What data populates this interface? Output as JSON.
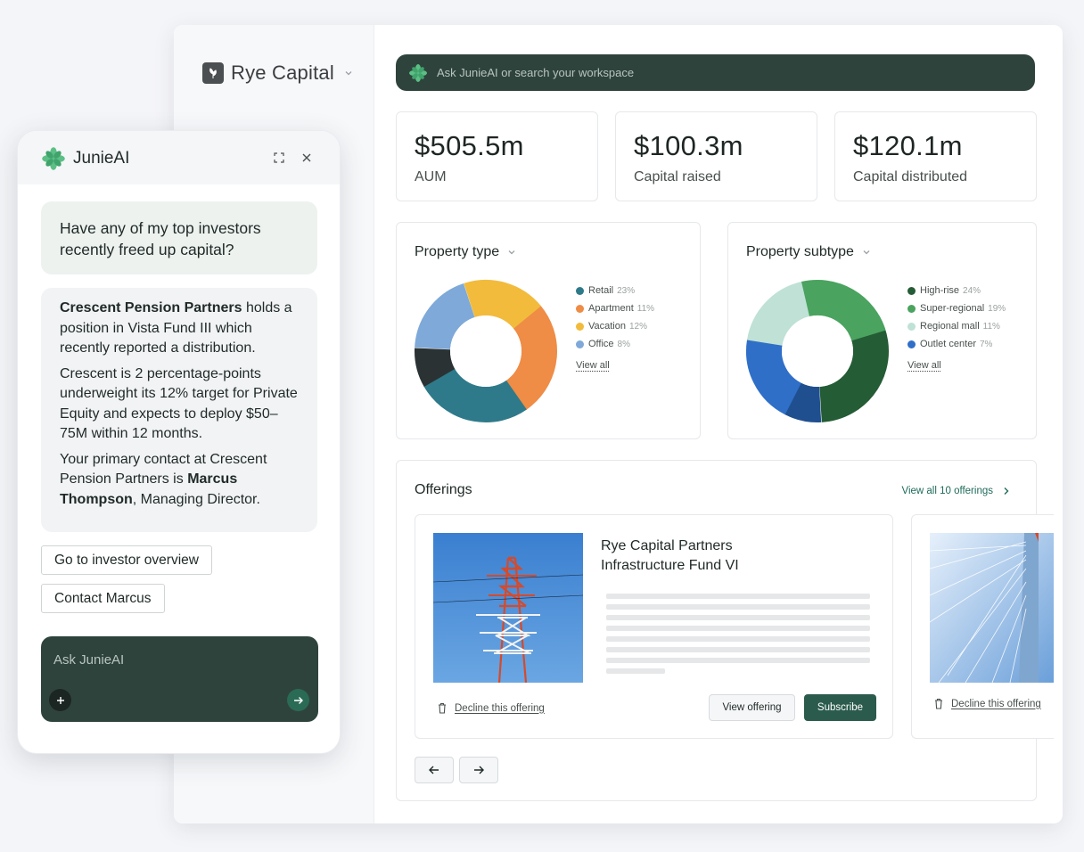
{
  "workspace": {
    "name": "Rye Capital"
  },
  "search": {
    "placeholder": "Ask JunieAI or search your workspace"
  },
  "stats": [
    {
      "value": "$505.5m",
      "label": "AUM"
    },
    {
      "value": "$100.3m",
      "label": "Capital raised"
    },
    {
      "value": "$120.1m",
      "label": "Capital distributed"
    }
  ],
  "property_type": {
    "title": "Property type",
    "legend": [
      {
        "label": "Retail",
        "pct": "23%",
        "color": "#2e7a8a"
      },
      {
        "label": "Apartment",
        "pct": "11%",
        "color": "#ef8c45"
      },
      {
        "label": "Vacation",
        "pct": "12%",
        "color": "#f2bb3c"
      },
      {
        "label": "Office",
        "pct": "8%",
        "color": "#7ea9d8"
      }
    ],
    "view_all": "View all"
  },
  "property_subtype": {
    "title": "Property subtype",
    "legend": [
      {
        "label": "High-rise",
        "pct": "24%",
        "color": "#245c35"
      },
      {
        "label": "Super-regional",
        "pct": "19%",
        "color": "#4aa35e"
      },
      {
        "label": "Regional mall",
        "pct": "11%",
        "color": "#bfe1d6"
      },
      {
        "label": "Outlet center",
        "pct": "7%",
        "color": "#2f6fc8"
      }
    ],
    "view_all": "View all"
  },
  "offerings": {
    "title": "Offerings",
    "view_all": "View all 10 offerings",
    "items": [
      {
        "name_line1": "Rye Capital Partners",
        "name_line2": "Infrastructure Fund VI",
        "decline": "Decline this offering",
        "view": "View offering",
        "subscribe": "Subscribe"
      },
      {
        "decline": "Decline this offering"
      }
    ]
  },
  "chat": {
    "title": "JunieAI",
    "user_message": "Have any of my top investors recently freed up capital?",
    "ai": {
      "p1_bold": "Crescent Pension Partners",
      "p1_rest": " holds a position in Vista Fund III which recently reported a distribution.",
      "p2": "Crescent is 2 percentage-points underweight its 12% target for Private Equity and expects to deploy $50–75M within 12 months.",
      "p3_start": "Your primary contact at Crescent Pension Partners is ",
      "p3_bold": "Marcus Thompson",
      "p3_end": ", Managing Director."
    },
    "actions": [
      "Go to investor overview",
      "Contact Marcus"
    ],
    "compose_placeholder": "Ask JunieAI"
  }
}
